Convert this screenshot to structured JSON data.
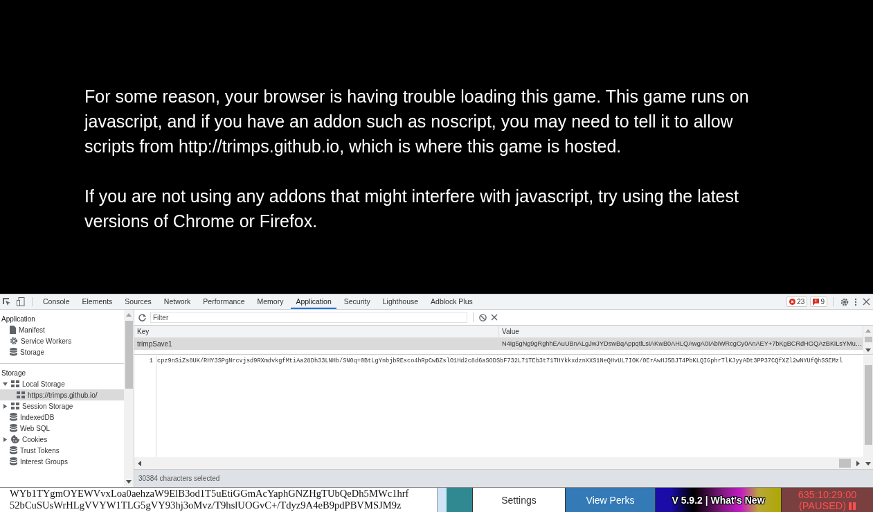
{
  "message": {
    "paragraphs": [
      "For some reason, your browser is having trouble loading this game. This game runs on javascript, and if you have an addon such as noscript, you may need to tell it to allow scripts from http://trimps.github.io, which is where this game is hosted.",
      "If you are not using any addons that might interfere with javascript, try using the latest versions of Chrome or Firefox."
    ]
  },
  "devtools": {
    "tabs": [
      {
        "label": "Console",
        "selected": false
      },
      {
        "label": "Elements",
        "selected": false
      },
      {
        "label": "Sources",
        "selected": false
      },
      {
        "label": "Network",
        "selected": false
      },
      {
        "label": "Performance",
        "selected": false
      },
      {
        "label": "Memory",
        "selected": false
      },
      {
        "label": "Application",
        "selected": true
      },
      {
        "label": "Security",
        "selected": false
      },
      {
        "label": "Lighthouse",
        "selected": false
      },
      {
        "label": "Adblock Plus",
        "selected": false
      }
    ],
    "error_count": "23",
    "issue_count": "9",
    "sidebar": [
      {
        "title": "Application",
        "items": [
          {
            "label": "Manifest",
            "kind": "file",
            "selected": false
          },
          {
            "label": "Service Workers",
            "kind": "gear",
            "selected": false
          },
          {
            "label": "Storage",
            "kind": "database",
            "selected": false
          }
        ]
      },
      {
        "title": "Storage",
        "items": [
          {
            "label": "Local Storage",
            "kind": "grid",
            "selected": false,
            "expanded": true,
            "children": [
              {
                "label": "https://trimps.github.io/",
                "kind": "grid",
                "selected": true
              }
            ]
          },
          {
            "label": "Session Storage",
            "kind": "grid",
            "selected": false,
            "expanded": false
          },
          {
            "label": "IndexedDB",
            "kind": "database",
            "selected": false
          },
          {
            "label": "Web SQL",
            "kind": "database",
            "selected": false
          },
          {
            "label": "Cookies",
            "kind": "cookie",
            "selected": false,
            "expanded": false
          },
          {
            "label": "Trust Tokens",
            "kind": "database",
            "selected": false
          },
          {
            "label": "Interest Groups",
            "kind": "database",
            "selected": false
          }
        ]
      }
    ],
    "filter": {
      "placeholder": "Filter"
    },
    "table": {
      "columns": [
        "Key",
        "Value"
      ],
      "rows": [
        {
          "key": "trimpSave1",
          "value": "N4Ig5gNg9gRghhEAuUBnALgJwJYDswBqAppqtlLsiAKwB0AHLQAwgA0IAbiWRcgCy0AnAEY+7bKgBCRdHGQAzBKiLsYMu…",
          "selected": true
        }
      ]
    },
    "editor": {
      "line_number": "1",
      "text": "cpz9nSiZs8UK/RHY3SPgNrcvjsd9RXmdvkgfMtiAa28Dh33LNHb/SN0q+0BtLgYnbjbREsco4hRpCwBZslO1Hd2c8d6aSODSbF732L71TEb3t71THYkkxdznXXS1NeQHvUL7IOK/0ErAwHJ5BJT4PbKLQIGphrTlKJyyADt3PP37CQfXZl2wNYUfQhSSEMzl"
    },
    "status": "30384 characters selected"
  },
  "game_bar": {
    "save_text": [
      "WYb1TYgmOYEWVvxLoa0aehzaW9ElB3od1T5uEtiGGmAcYaphGNZHgTUbQeDh5MWc1hrf",
      "52bCuSUsWrHLgVVYW1TLG5gVY93hj3oMvz/T9hslUOGvC+/Tdyz9A4eB9pdPBVMSJM9z"
    ],
    "buttons": [
      {
        "kind": "edge"
      },
      {
        "kind": "plain"
      },
      {
        "kind": "light",
        "label": "Settings"
      },
      {
        "kind": "blue",
        "label": "View Perks"
      },
      {
        "kind": "rainbow",
        "label": "V 5.9.2 | What's New"
      }
    ],
    "timer": {
      "time": "635:10:29:00",
      "state": "(PAUSED)",
      "paused": true
    }
  }
}
